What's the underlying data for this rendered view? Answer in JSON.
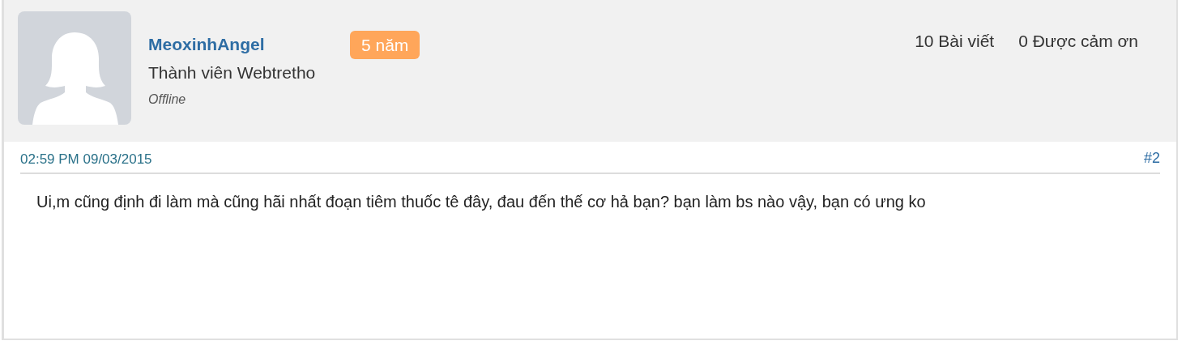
{
  "author": {
    "name": "MeoxinhAngel",
    "badge": "5 năm",
    "rank": "Thành viên Webtretho",
    "status": "Offline"
  },
  "stats": [
    "10 Bài viết",
    "0 Được cảm ơn"
  ],
  "post": {
    "date": "02:59 PM 09/03/2015",
    "number": "#2",
    "body": "Ui,m cũng định đi làm mà cũng hãi nhất đoạn tiêm thuốc tê đây, đau đến thế cơ hả bạn? bạn làm bs nào vậy, bạn có ưng ko"
  }
}
